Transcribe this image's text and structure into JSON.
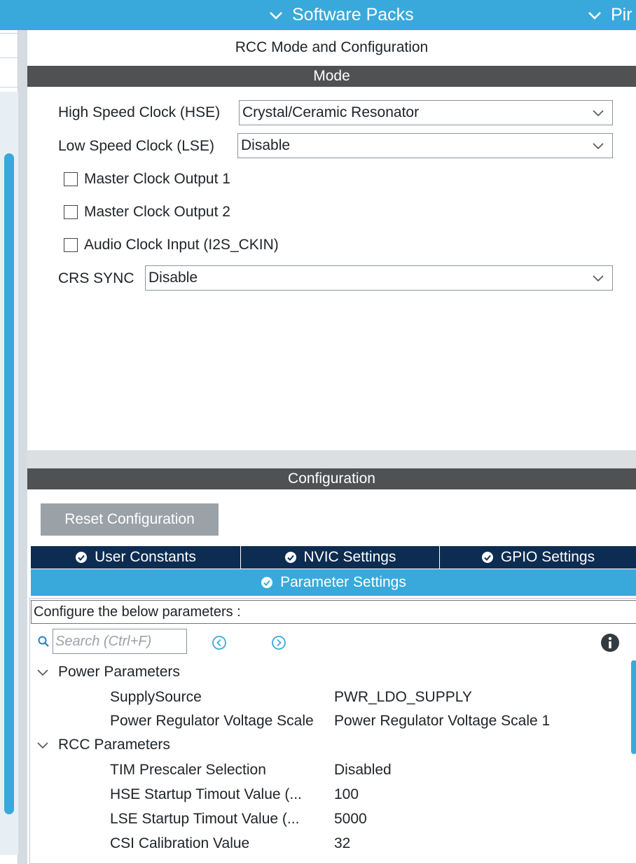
{
  "topbar": {
    "software_packs": "Software Packs",
    "pinout": "Pir"
  },
  "panel": {
    "title": "RCC Mode and Configuration",
    "mode_header": "Mode",
    "hse_label": "High Speed Clock (HSE)",
    "hse_value": "Crystal/Ceramic Resonator",
    "lse_label": "Low Speed Clock (LSE)",
    "lse_value": "Disable",
    "checkboxes": [
      {
        "label": "Master Clock Output 1",
        "checked": false
      },
      {
        "label": "Master Clock Output 2",
        "checked": false
      },
      {
        "label": "Audio Clock Input (I2S_CKIN)",
        "checked": false
      }
    ],
    "crs_label": "CRS SYNC",
    "crs_value": "Disable",
    "config_header": "Configuration",
    "reset_button": "Reset Configuration"
  },
  "tabs": {
    "user_constants": "User Constants",
    "nvic": "NVIC Settings",
    "gpio": "GPIO Settings",
    "parameter": "Parameter Settings"
  },
  "params": {
    "configure_text": "Configure the below parameters :",
    "search_placeholder": "Search (Ctrl+F)",
    "groups": [
      {
        "name": "Power Parameters",
        "items": [
          {
            "name": "SupplySource",
            "value": "PWR_LDO_SUPPLY"
          },
          {
            "name": "Power Regulator Voltage Scale",
            "value": "Power Regulator Voltage Scale 1"
          }
        ]
      },
      {
        "name": "RCC Parameters",
        "items": [
          {
            "name": "TIM Prescaler Selection",
            "value": "Disabled"
          },
          {
            "name": "HSE Startup Timout Value (...",
            "value": "100"
          },
          {
            "name": "LSE Startup Timout Value (...",
            "value": "5000"
          },
          {
            "name": "CSI Calibration Value",
            "value": "32"
          }
        ]
      }
    ]
  },
  "colors": {
    "accent": "#39a9db",
    "dark_tab": "#0d2c52",
    "section_bar": "#4f5153",
    "button_gray": "#9aa2a8"
  },
  "icons": {
    "topbar_chevron": "chevron-down-icon",
    "select_chevron": "chevron-down-icon",
    "tab_ok": "check-circle-icon",
    "search": "search-icon",
    "nav_prev": "circle-arrow-left-icon",
    "nav_next": "circle-arrow-right-icon",
    "info": "info-icon",
    "tree_chevron": "chevron-down-icon"
  }
}
